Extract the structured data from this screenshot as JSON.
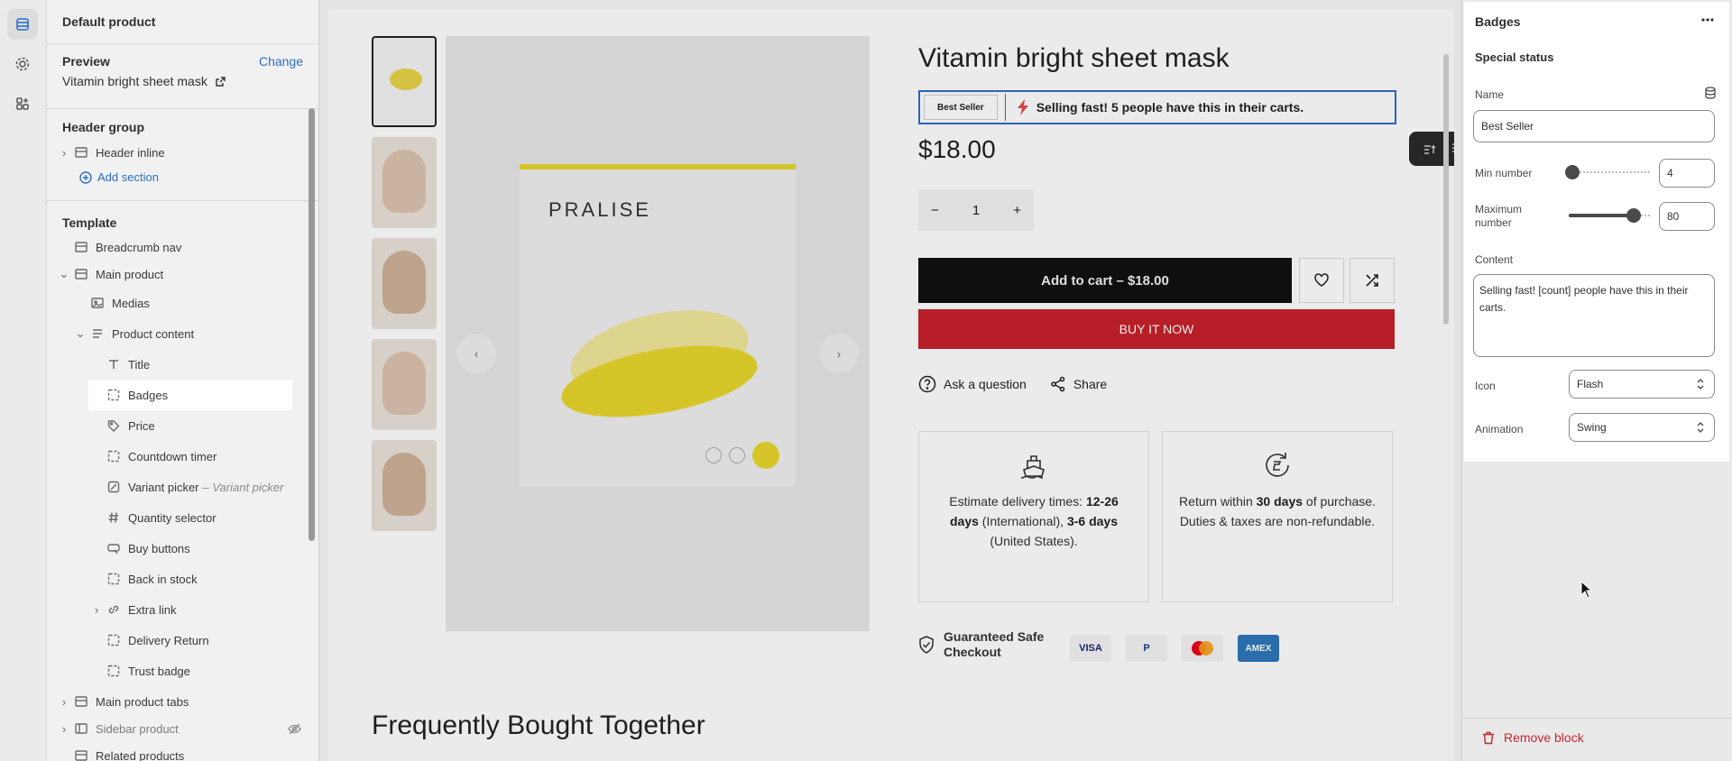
{
  "sidebar": {
    "title": "Default product",
    "preview_label": "Preview",
    "change_label": "Change",
    "preview_value": "Vitamin bright sheet mask",
    "header_group": "Header group",
    "header_inline": "Header inline",
    "add_section": "Add section",
    "template": "Template",
    "items": [
      {
        "label": "Breadcrumb nav"
      },
      {
        "label": "Main product"
      },
      {
        "label": "Medias"
      },
      {
        "label": "Product content"
      },
      {
        "label": "Title"
      },
      {
        "label": "Badges"
      },
      {
        "label": "Price"
      },
      {
        "label": "Countdown timer"
      },
      {
        "label": "Variant picker",
        "suffix": "– Variant picker"
      },
      {
        "label": "Quantity selector"
      },
      {
        "label": "Buy buttons"
      },
      {
        "label": "Back in stock"
      },
      {
        "label": "Extra link"
      },
      {
        "label": "Delivery Return"
      },
      {
        "label": "Trust badge"
      },
      {
        "label": "Main product tabs"
      },
      {
        "label": "Sidebar product"
      },
      {
        "label": "Related products"
      }
    ]
  },
  "product": {
    "title": "Vitamin bright sheet mask",
    "badge": "Best Seller",
    "badge_text": "Selling fast! 5 people have this in their carts.",
    "price": "$18.00",
    "quantity": "1",
    "add_to_cart": "Add to cart – $18.00",
    "buy_now": "BUY IT NOW",
    "ask_question": "Ask a question",
    "share": "Share",
    "brand": "PRALISE",
    "delivery": {
      "prefix": "Estimate delivery times: ",
      "b1": "12-26 days",
      "mid1": " (International), ",
      "b2": "3-6 days",
      "end": " (United States)."
    },
    "returns": {
      "prefix": "Return within ",
      "b1": "30 days",
      "end": " of purchase. Duties & taxes are non-refundable."
    },
    "safe_checkout": "Guaranteed Safe Checkout",
    "payments": [
      "VISA",
      "P",
      "",
      "AMEX"
    ],
    "frequently_bought": "Frequently Bought Together"
  },
  "panel": {
    "title": "Badges",
    "subtitle": "Special status",
    "name_label": "Name",
    "name_value": "Best Seller",
    "min_label": "Min number",
    "min_value": "4",
    "max_label": "Maximum number",
    "max_value": "80",
    "content_label": "Content",
    "content_value": "Selling fast! [count] people have this in their carts.",
    "icon_label": "Icon",
    "icon_value": "Flash",
    "animation_label": "Animation",
    "animation_value": "Swing",
    "remove_block": "Remove block"
  },
  "colors": {
    "accent": "#2c6ecb",
    "buy_now": "#c8212b",
    "remove": "#c5282f"
  }
}
